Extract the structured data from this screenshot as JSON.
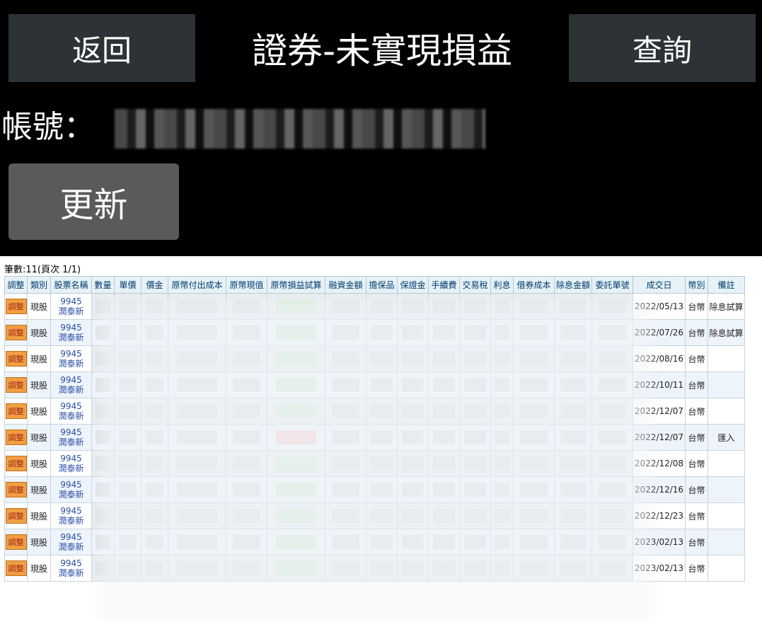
{
  "header": {
    "back_label": "返回",
    "title": "證券-未實現損益",
    "query_label": "查詢"
  },
  "account": {
    "label": "帳號："
  },
  "refresh_label": "更新",
  "table": {
    "count_text": "筆數:11(頁次 1/1)",
    "headers": [
      "調整",
      "類別",
      "股票名稱",
      "數量",
      "單價",
      "價金",
      "原幣付出成本",
      "原幣現值",
      "原幣損益試算",
      "融資金額",
      "擔保品",
      "保證金",
      "手續費",
      "交易稅",
      "利息",
      "借券成本",
      "除息金額",
      "委託單號",
      "成交日",
      "幣別",
      "備註"
    ],
    "adjust_label": "調整",
    "rows": [
      {
        "type": "現股",
        "code": "9945",
        "name": "潤泰新",
        "date": "2022/05/13",
        "currency": "台幣",
        "note": "除息試算",
        "pl": "g"
      },
      {
        "type": "現股",
        "code": "9945",
        "name": "潤泰新",
        "date": "2022/07/26",
        "currency": "台幣",
        "note": "除息試算",
        "pl": "g"
      },
      {
        "type": "現股",
        "code": "9945",
        "name": "潤泰新",
        "date": "2022/08/16",
        "currency": "台幣",
        "note": "",
        "pl": "g"
      },
      {
        "type": "現股",
        "code": "9945",
        "name": "潤泰新",
        "date": "2022/10/11",
        "currency": "台幣",
        "note": "",
        "pl": "g"
      },
      {
        "type": "現股",
        "code": "9945",
        "name": "潤泰新",
        "date": "2022/12/07",
        "currency": "台幣",
        "note": "",
        "pl": "g"
      },
      {
        "type": "現股",
        "code": "9945",
        "name": "潤泰新",
        "date": "2022/12/07",
        "currency": "台幣",
        "note": "匯入",
        "pl": "r"
      },
      {
        "type": "現股",
        "code": "9945",
        "name": "潤泰新",
        "date": "2022/12/08",
        "currency": "台幣",
        "note": "",
        "pl": "g"
      },
      {
        "type": "現股",
        "code": "9945",
        "name": "潤泰新",
        "date": "2022/12/16",
        "currency": "台幣",
        "note": "",
        "pl": "g"
      },
      {
        "type": "現股",
        "code": "9945",
        "name": "潤泰新",
        "date": "2022/12/23",
        "currency": "台幣",
        "note": "",
        "pl": "g"
      },
      {
        "type": "現股",
        "code": "9945",
        "name": "潤泰新",
        "date": "2023/02/13",
        "currency": "台幣",
        "note": "",
        "pl": "g"
      },
      {
        "type": "現股",
        "code": "9945",
        "name": "潤泰新",
        "date": "2023/02/13",
        "currency": "台幣",
        "note": "",
        "pl": "g"
      }
    ]
  },
  "colors": {
    "button_dark": "#2d3236",
    "button_gray": "#5a5a5a",
    "header_bg": "#e6f2f7",
    "adjust_badge": "#f0a040",
    "stock_link": "#2a4fa8"
  }
}
